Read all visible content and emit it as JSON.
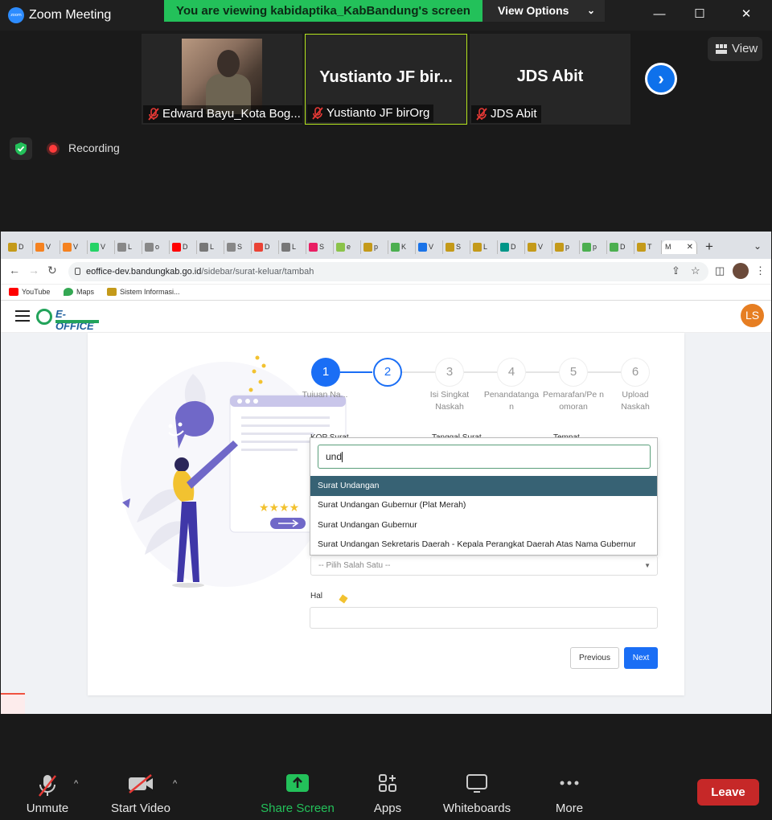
{
  "zoom": {
    "title": "Zoom Meeting",
    "logo_text": "zoom",
    "banner": "You are viewing kabidaptika_KabBandung's screen",
    "view_options": "View Options",
    "view_button": "View",
    "recording": "Recording",
    "participants": [
      {
        "display": "",
        "label": "Edward Bayu_Kota Bog..."
      },
      {
        "display": "Yustianto JF bir...",
        "label": "Yustianto JF birOrg"
      },
      {
        "display": "JDS Abit",
        "label": "JDS Abit"
      }
    ],
    "toolbar": {
      "unmute": "Unmute",
      "start_video": "Start Video",
      "share_screen": "Share Screen",
      "apps": "Apps",
      "whiteboards": "Whiteboards",
      "more": "More",
      "leave": "Leave"
    },
    "colors": {
      "share_green": "#23c15a",
      "leave_red": "#c62828",
      "accent_blue": "#0e71eb"
    }
  },
  "browser": {
    "tabs": [
      "D",
      "V",
      "V",
      "V",
      "L",
      "o",
      "D",
      "L",
      "S",
      "D",
      "L",
      "S",
      "e",
      "p",
      "K",
      "V",
      "S",
      "L",
      "D",
      "V",
      "p",
      "p",
      "D",
      "T"
    ],
    "active_tab": "M",
    "url_domain": "eoffice-dev.bandungkab.go.id",
    "url_path": "/sidebar/surat-keluar/tambah",
    "bookmarks": [
      "YouTube",
      "Maps",
      "Sistem Informasi..."
    ]
  },
  "app": {
    "logo": "E-OFFICE",
    "user_initials": "LS",
    "steps": [
      {
        "num": "1",
        "label": "Tujuan Na..."
      },
      {
        "num": "2",
        "label": ""
      },
      {
        "num": "3",
        "label": "Isi Singkat Naskah"
      },
      {
        "num": "4",
        "label": "Penandatanga n"
      },
      {
        "num": "5",
        "label": "Pemarafan/Pe nomoran"
      },
      {
        "num": "6",
        "label": "Upload Naskah"
      }
    ],
    "partial_labels": [
      "KOP Surat",
      "Tanggal Surat",
      "Tempat"
    ],
    "search_value": "und",
    "options": [
      "Surat Undangan",
      "Surat Undangan Gubernur (Plat Merah)",
      "Surat Undangan Gubernur",
      "Surat Undangan Sekretaris Daerah - Kepala Perangkat Daerah Atas Nama Gubernur"
    ],
    "select_placeholder": "-- Pilih Salah Satu --",
    "hal_label": "Hal",
    "previous": "Previous",
    "next": "Next"
  }
}
